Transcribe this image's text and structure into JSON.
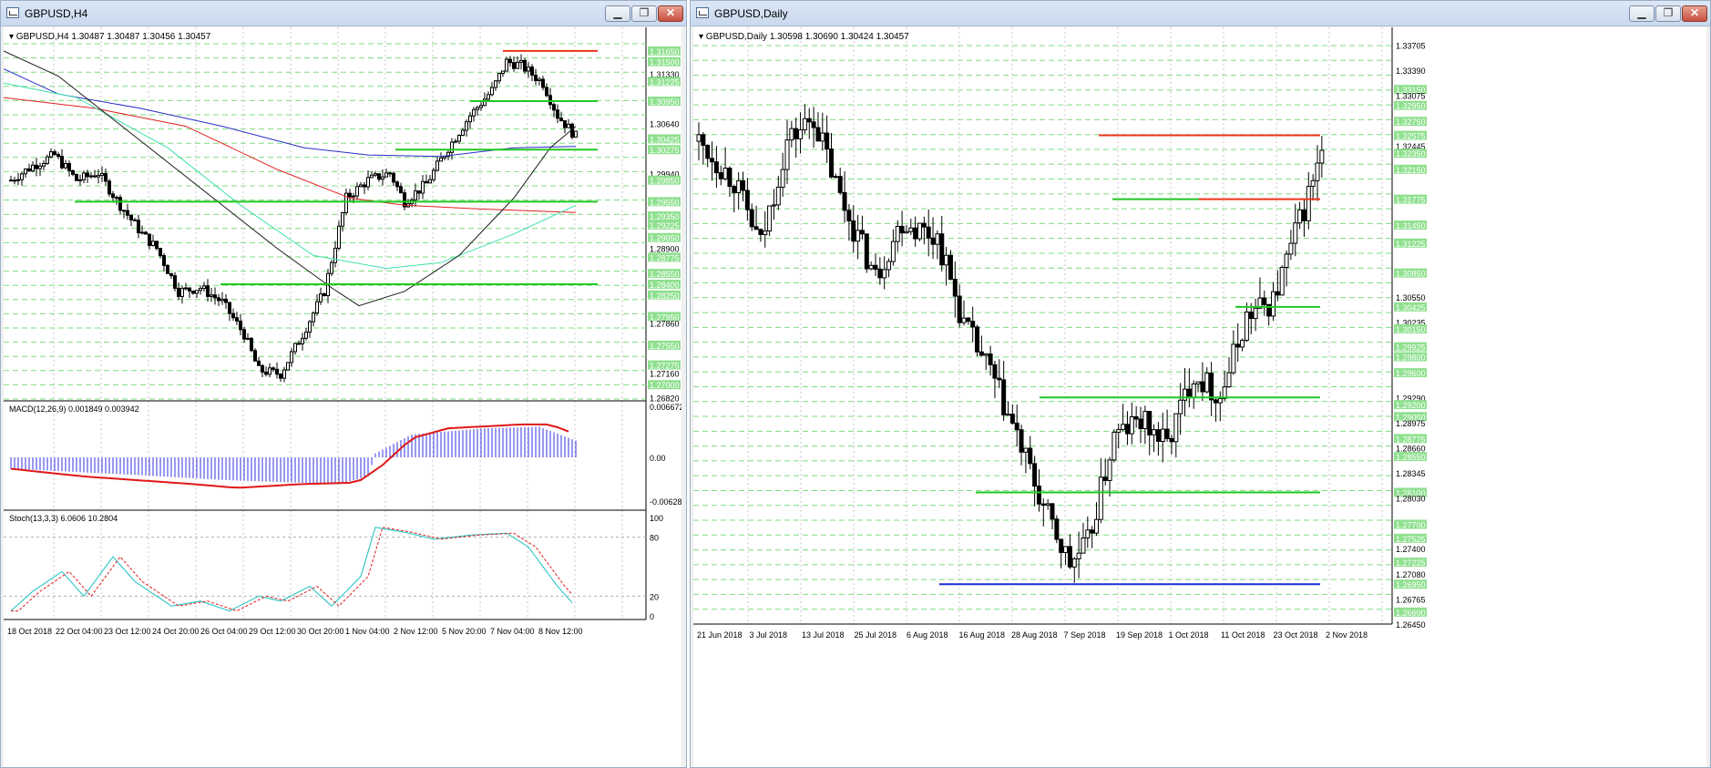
{
  "left_window": {
    "title": "GBPUSD,H4",
    "buttons": {
      "minimize": "▁",
      "restore": "❐",
      "close": "✕"
    },
    "header_text": "▾ GBPUSD,H4  1.30487 1.30487 1.30456 1.30457",
    "price_axis_labels": [
      "1.31650",
      "1.31500",
      "1.31330",
      "1.31225",
      "1.30950",
      "1.30640",
      "1.30425",
      "1.30275",
      "1.29940",
      "1.29850",
      "1.29550",
      "1.29350",
      "1.29225",
      "1.29050",
      "1.28900",
      "1.28775",
      "1.28550",
      "1.28400",
      "1.28250",
      "1.27950",
      "1.27860",
      "1.27550",
      "1.27275",
      "1.27160",
      "1.27000",
      "1.26820"
    ],
    "highlighted_price_labels": [
      "1.31650",
      "1.31500",
      "1.31225",
      "1.30950",
      "1.30425",
      "1.30275",
      "1.29850",
      "1.29550",
      "1.29350",
      "1.29225",
      "1.29050",
      "1.28775",
      "1.28550",
      "1.28400",
      "1.28250",
      "1.27950",
      "1.27550",
      "1.27275",
      "1.27000"
    ],
    "macd_label": "MACD(12,26,9) 0.001849 0.003942",
    "macd_axis": [
      "0.006672",
      "0.00",
      "-0.006284"
    ],
    "stoch_label": "Stoch(13,3,3) 6.0606 10.2804",
    "stoch_axis": [
      "100",
      "80",
      "20",
      "0"
    ],
    "time_axis": [
      "18 Oct 2018",
      "22 Oct 04:00",
      "23 Oct 12:00",
      "24 Oct 20:00",
      "26 Oct 04:00",
      "29 Oct 12:00",
      "30 Oct 20:00",
      "1 Nov 04:00",
      "2 Nov 12:00",
      "5 Nov 20:00",
      "7 Nov 04:00",
      "8 Nov 12:00"
    ]
  },
  "right_window": {
    "title": "GBPUSD,Daily",
    "buttons": {
      "minimize": "▁",
      "restore": "❐",
      "close": "✕"
    },
    "header_text": "▾ GBPUSD,Daily  1.30598 1.30690 1.30424 1.30457",
    "price_axis_labels": [
      "1.33705",
      "1.33390",
      "1.33150",
      "1.33075",
      "1.32950",
      "1.32750",
      "1.32575",
      "1.32445",
      "1.32350",
      "1.32150",
      "1.31775",
      "1.31450",
      "1.31225",
      "1.30850",
      "1.30550",
      "1.30425",
      "1.30235",
      "1.30150",
      "1.29925",
      "1.29800",
      "1.29600",
      "1.29290",
      "1.29200",
      "1.29050",
      "1.28975",
      "1.28775",
      "1.28660",
      "1.28550",
      "1.28345",
      "1.28100",
      "1.28030",
      "1.27700",
      "1.27525",
      "1.27400",
      "1.27225",
      "1.27080",
      "1.26950",
      "1.26765",
      "1.26600",
      "1.26450"
    ],
    "highlighted_price_labels": [
      "1.33150",
      "1.32950",
      "1.32750",
      "1.32575",
      "1.32350",
      "1.32150",
      "1.31775",
      "1.31450",
      "1.31225",
      "1.30850",
      "1.30425",
      "1.30150",
      "1.29925",
      "1.29800",
      "1.29600",
      "1.29200",
      "1.29050",
      "1.28775",
      "1.28550",
      "1.28100",
      "1.27700",
      "1.27525",
      "1.27225",
      "1.26950",
      "1.26600"
    ],
    "time_axis": [
      "21 Jun 2018",
      "3 Jul 2018",
      "13 Jul 2018",
      "25 Jul 2018",
      "6 Aug 2018",
      "16 Aug 2018",
      "28 Aug 2018",
      "7 Sep 2018",
      "19 Sep 2018",
      "1 Oct 2018",
      "11 Oct 2018",
      "23 Oct 2018",
      "2 Nov 2018"
    ]
  },
  "colors": {
    "bull": "#ffffff",
    "bear": "#000000",
    "support_green": "#22c722",
    "resistance_red": "#e8341c",
    "support_blue": "#1a2fd6",
    "grid_green": "#7fdc7f",
    "macd_hist": "#3333e0",
    "macd_signal": "#e01818",
    "stoch_main": "#3cc8c8",
    "stoch_signal": "#e01818",
    "ma_black": "#1a1a1a",
    "ma_blue": "#2b2bc8",
    "ma_red": "#e02020",
    "ma_teal": "#40e0b0",
    "label_bg": "#8fe08f"
  }
}
